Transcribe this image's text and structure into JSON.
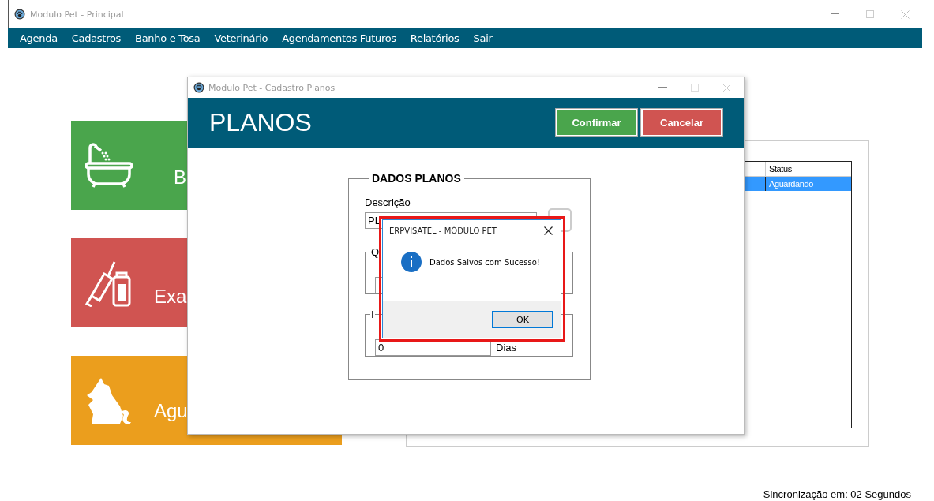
{
  "main_window": {
    "title": "Modulo Pet - Principal"
  },
  "menu": [
    "Agenda",
    "Cadastros",
    "Banho e Tosa",
    "Veterinário",
    "Agendamentos Futuros",
    "Relatórios",
    "Sair"
  ],
  "tiles": [
    {
      "label": "B",
      "kind": "bath",
      "color": "#4aa54c"
    },
    {
      "label": "Exa",
      "kind": "vaccine",
      "color": "#d05451"
    },
    {
      "label": "Agu",
      "kind": "pets",
      "color": "#eb9e1d"
    }
  ],
  "table": {
    "columns": [
      "Status"
    ],
    "rows": [
      {
        "cells": [
          "Aguardando"
        ],
        "selected": true
      }
    ]
  },
  "dialog": {
    "title": "Modulo Pet - Cadastro Planos",
    "heading": "PLANOS",
    "buttons": [
      {
        "label": "Confirmar",
        "kind": "confirm"
      },
      {
        "label": "Cancelar",
        "kind": "cancel"
      }
    ],
    "group": {
      "title": "DADOS PLANOS",
      "description_label": "Descrição",
      "description_value": "PL",
      "subgroups": [
        {
          "title": "Q"
        },
        {
          "title": "I",
          "value": "0",
          "unit": "Dias"
        }
      ]
    }
  },
  "message_box": {
    "title": "ERPVISATEL - MÓDULO PET",
    "message": "Dados Salvos com Sucesso!",
    "button": "OK"
  },
  "status_bar": "Sincronização em: 02 Segundos"
}
